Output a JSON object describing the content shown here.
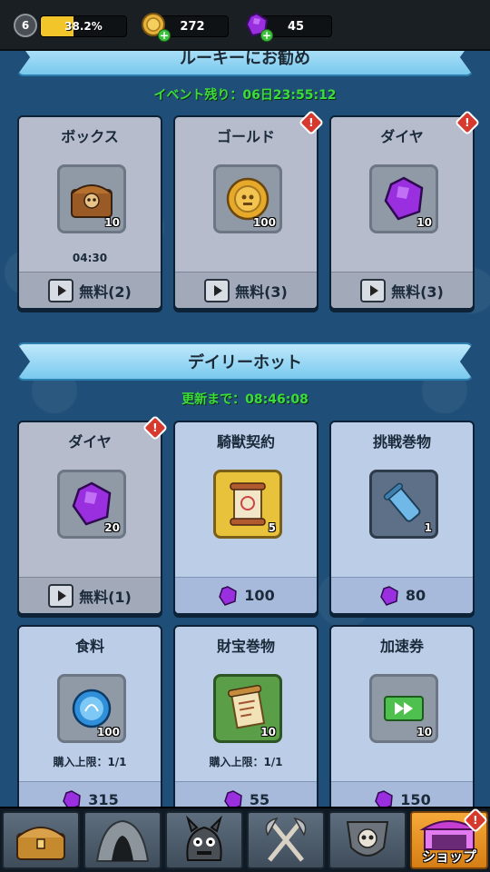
{
  "topbar": {
    "level": "6",
    "xp_percent_text": "38.2%",
    "xp_fraction": 0.382,
    "gold": "272",
    "gems": "45"
  },
  "section1": {
    "title": "ルーキーにお勧め",
    "countdown": "イベント残り：06日23:55:12",
    "cards": [
      {
        "title": "ボックス",
        "qty": "10",
        "timer": "04:30",
        "price": "無料(2)",
        "icon": "treasure-chest-icon",
        "alert": false
      },
      {
        "title": "ゴールド",
        "qty": "100",
        "price": "無料(3)",
        "icon": "gold-coin-icon",
        "alert": true
      },
      {
        "title": "ダイヤ",
        "qty": "10",
        "price": "無料(3)",
        "icon": "purple-gem-icon",
        "alert": true
      }
    ]
  },
  "section2": {
    "title": "デイリーホット",
    "countdown": "更新まで：08:46:08",
    "cards": [
      {
        "title": "ダイヤ",
        "qty": "20",
        "price": "無料(1)",
        "icon": "purple-gem-icon",
        "alert": true
      },
      {
        "title": "騎獣契約",
        "qty": "5",
        "price": "100",
        "icon": "mount-contract-scroll-icon",
        "alert": false
      },
      {
        "title": "挑戦巻物",
        "qty": "1",
        "price": "80",
        "icon": "challenge-scroll-icon",
        "alert": false
      },
      {
        "title": "食料",
        "qty": "100",
        "limit": "購入上限：1/1",
        "price": "315",
        "icon": "food-orb-icon",
        "alert": false
      },
      {
        "title": "財宝巻物",
        "qty": "10",
        "limit": "購入上限：1/1",
        "price": "55",
        "icon": "treasure-scroll-icon",
        "alert": false
      },
      {
        "title": "加速券",
        "qty": "10",
        "price": "150",
        "icon": "speed-ticket-icon",
        "alert": false
      }
    ]
  },
  "bottom_nav": {
    "tabs": [
      {
        "name": "chest",
        "icon": "treasure-chest-icon"
      },
      {
        "name": "cave",
        "icon": "cave-icon"
      },
      {
        "name": "monster",
        "icon": "monster-icon"
      },
      {
        "name": "weapons",
        "icon": "crossed-axes-icon"
      },
      {
        "name": "guild",
        "icon": "skull-shield-icon"
      },
      {
        "name": "shop",
        "icon": "shop-tent-icon",
        "label": "ショップ",
        "active": true
      }
    ]
  },
  "colors": {
    "background": "#1f4f78",
    "countdown": "#3cdc3c",
    "gem": "#9a2fe0",
    "gold": "#e7b23a",
    "active_tab": "#f5a938"
  }
}
